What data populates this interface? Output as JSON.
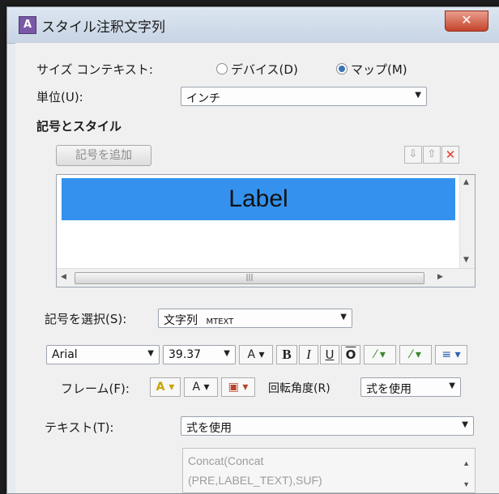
{
  "window": {
    "title": "スタイル注釈文字列",
    "close_glyph": "✕"
  },
  "size_context": {
    "label": "サイズ コンテキスト:",
    "options": [
      {
        "label": "デバイス(D)",
        "selected": false
      },
      {
        "label": "マップ(M)",
        "selected": true
      }
    ]
  },
  "unit": {
    "label": "単位(U):",
    "value": "インチ"
  },
  "symbols": {
    "heading": "記号とスタイル",
    "add_button": "記号を追加",
    "list_item": "Label"
  },
  "symbol_select": {
    "label": "記号を選択(S):",
    "value_main": "文字列",
    "value_sub": "MTEXT"
  },
  "font": {
    "name": "Arial",
    "size": "39.37"
  },
  "format_buttons": {
    "bold": "B",
    "italic": "I",
    "underline": "U",
    "overline": "O"
  },
  "frame": {
    "label": "フレーム(F):"
  },
  "rotation": {
    "label": "回転角度(R)",
    "value": "式を使用"
  },
  "text": {
    "label": "テキスト(T):",
    "value": "式を使用",
    "expression_line1": "Concat(Concat",
    "expression_line2": "(PRE,LABEL_TEXT),SUF)"
  },
  "colors": {
    "selection": "#3492ee",
    "remove_icon": "#e03a2c"
  }
}
